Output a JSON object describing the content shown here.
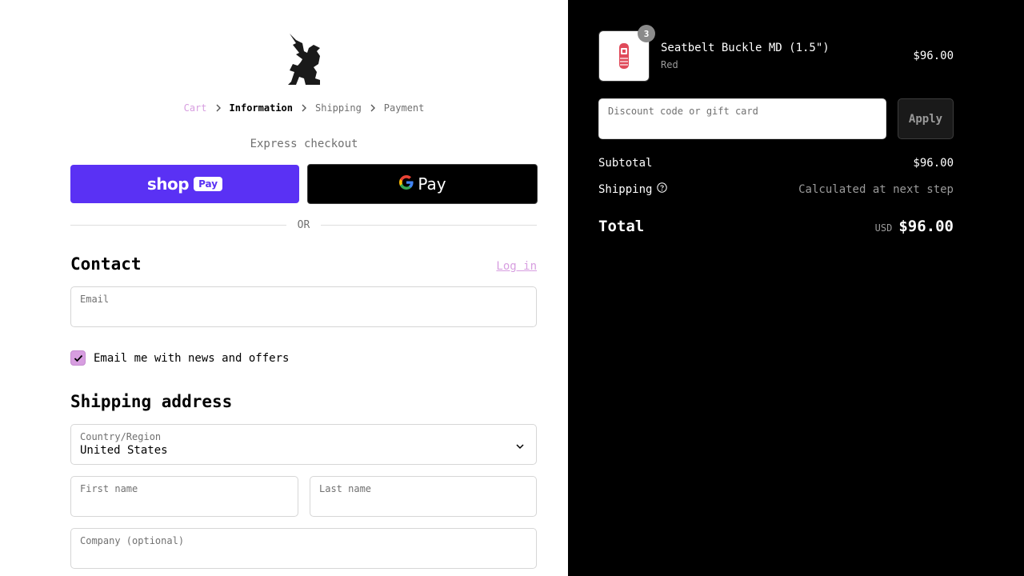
{
  "breadcrumb": {
    "items": [
      "Cart",
      "Information",
      "Shipping",
      "Payment"
    ]
  },
  "express": {
    "label": "Express checkout",
    "shop_pay_word": "shop",
    "shop_pay_pill": "Pay",
    "google_pay_word": "Pay"
  },
  "or_label": "OR",
  "contact": {
    "heading": "Contact",
    "login_link": "Log in",
    "email_label": "Email",
    "email_value": "",
    "newsletter_label": "Email me with news and offers",
    "newsletter_checked": true
  },
  "shipping_address": {
    "heading": "Shipping address",
    "country_label": "Country/Region",
    "country_value": "United States",
    "first_name_label": "First name",
    "last_name_label": "Last name",
    "company_label": "Company (optional)"
  },
  "order": {
    "item": {
      "name": "Seatbelt Buckle MD (1.5\")",
      "variant": "Red",
      "price": "$96.00",
      "quantity": "3"
    },
    "discount_placeholder": "Discount code or gift card",
    "apply_label": "Apply",
    "subtotal_label": "Subtotal",
    "subtotal_value": "$96.00",
    "shipping_label": "Shipping",
    "shipping_value": "Calculated at next step",
    "total_label": "Total",
    "total_currency": "USD",
    "total_value": "$96.00"
  },
  "colors": {
    "accent": "#d79ee0",
    "shop_pay": "#5a31f4",
    "summary_bg": "#000000"
  },
  "icons": {
    "logo": "griffin-logo",
    "breadcrumb_separator": "chevron-right-icon",
    "country_select": "chevron-down-icon",
    "shipping_help": "question-circle-icon",
    "checkbox": "checkmark-icon"
  }
}
